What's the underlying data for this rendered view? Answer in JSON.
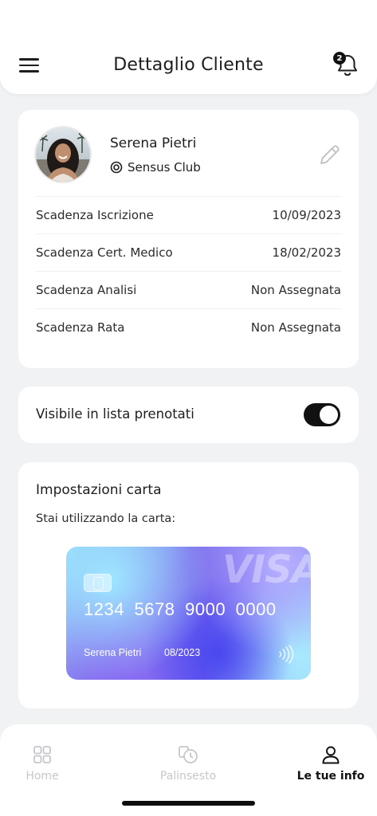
{
  "header": {
    "title": "Dettaglio Cliente",
    "menu_icon": "hamburger-menu-icon",
    "notification_icon": "bell-icon",
    "notification_count": "2"
  },
  "profile": {
    "name": "Serena Pietri",
    "club": "Sensus Club",
    "club_icon": "target-icon",
    "edit_icon": "pencil-icon",
    "rows": [
      {
        "label": "Scadenza Iscrizione",
        "value": "10/09/2023"
      },
      {
        "label": "Scadenza Cert. Medico",
        "value": "18/02/2023"
      },
      {
        "label": "Scadenza Analisi",
        "value": "Non Assegnata"
      },
      {
        "label": "Scadenza Rata",
        "value": "Non Assegnata"
      }
    ]
  },
  "visibility": {
    "label": "Visibile in lista prenotati",
    "enabled": true
  },
  "card_settings": {
    "title": "Impostazioni carta",
    "subtitle": "Stai utilizzando la carta:",
    "card": {
      "brand": "VISA",
      "number": "1234 5678 9000 0000",
      "holder": "Serena Pietri",
      "expiry": "08/2023"
    }
  },
  "tabbar": {
    "tabs": [
      {
        "label": "Home",
        "icon": "grid-icon",
        "active": false
      },
      {
        "label": "Palinsesto",
        "icon": "schedule-icon",
        "active": false
      },
      {
        "label": "Le tue info",
        "icon": "user-icon",
        "active": true
      }
    ]
  },
  "colors": {
    "background": "#f1f2f4",
    "surface": "#ffffff",
    "text": "#1d1d1f",
    "toggle_on": "#111111",
    "inactive_tab": "#c5c7cc"
  }
}
